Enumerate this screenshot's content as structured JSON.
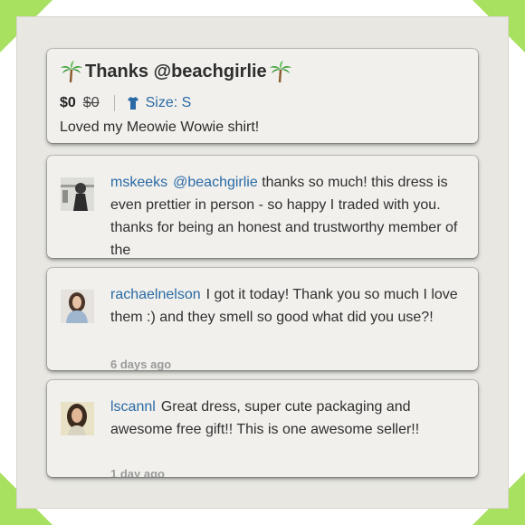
{
  "header": {
    "title": "Thanks @beachgirlie",
    "price": "$0",
    "original_price": "$0",
    "size": "Size: S",
    "caption": "Loved my Meowie Wowie shirt!"
  },
  "comments": [
    {
      "username": "mskeeks",
      "mention": "@beachgirlie",
      "text": " thanks so much! this dress is even prettier in person - so happy I traded with you. thanks for being an honest and trustworthy member of the",
      "time": ""
    },
    {
      "username": "rachaelnelson",
      "mention": "",
      "text": "I got it today! Thank you so much I love them :) and they smell so good what did you use?!",
      "time": "6 days ago"
    },
    {
      "username": "lscannl",
      "mention": "",
      "text": "Great dress, super cute packaging and awesome free gift!! This is one awesome seller!!",
      "time": "1 day ago"
    }
  ],
  "colors": {
    "link": "#2a6aa6",
    "corner_accent": "#a8e05f",
    "card_bg": "#f1f0ec"
  },
  "icons": [
    "palm-tree-icon",
    "shirt-icon"
  ]
}
